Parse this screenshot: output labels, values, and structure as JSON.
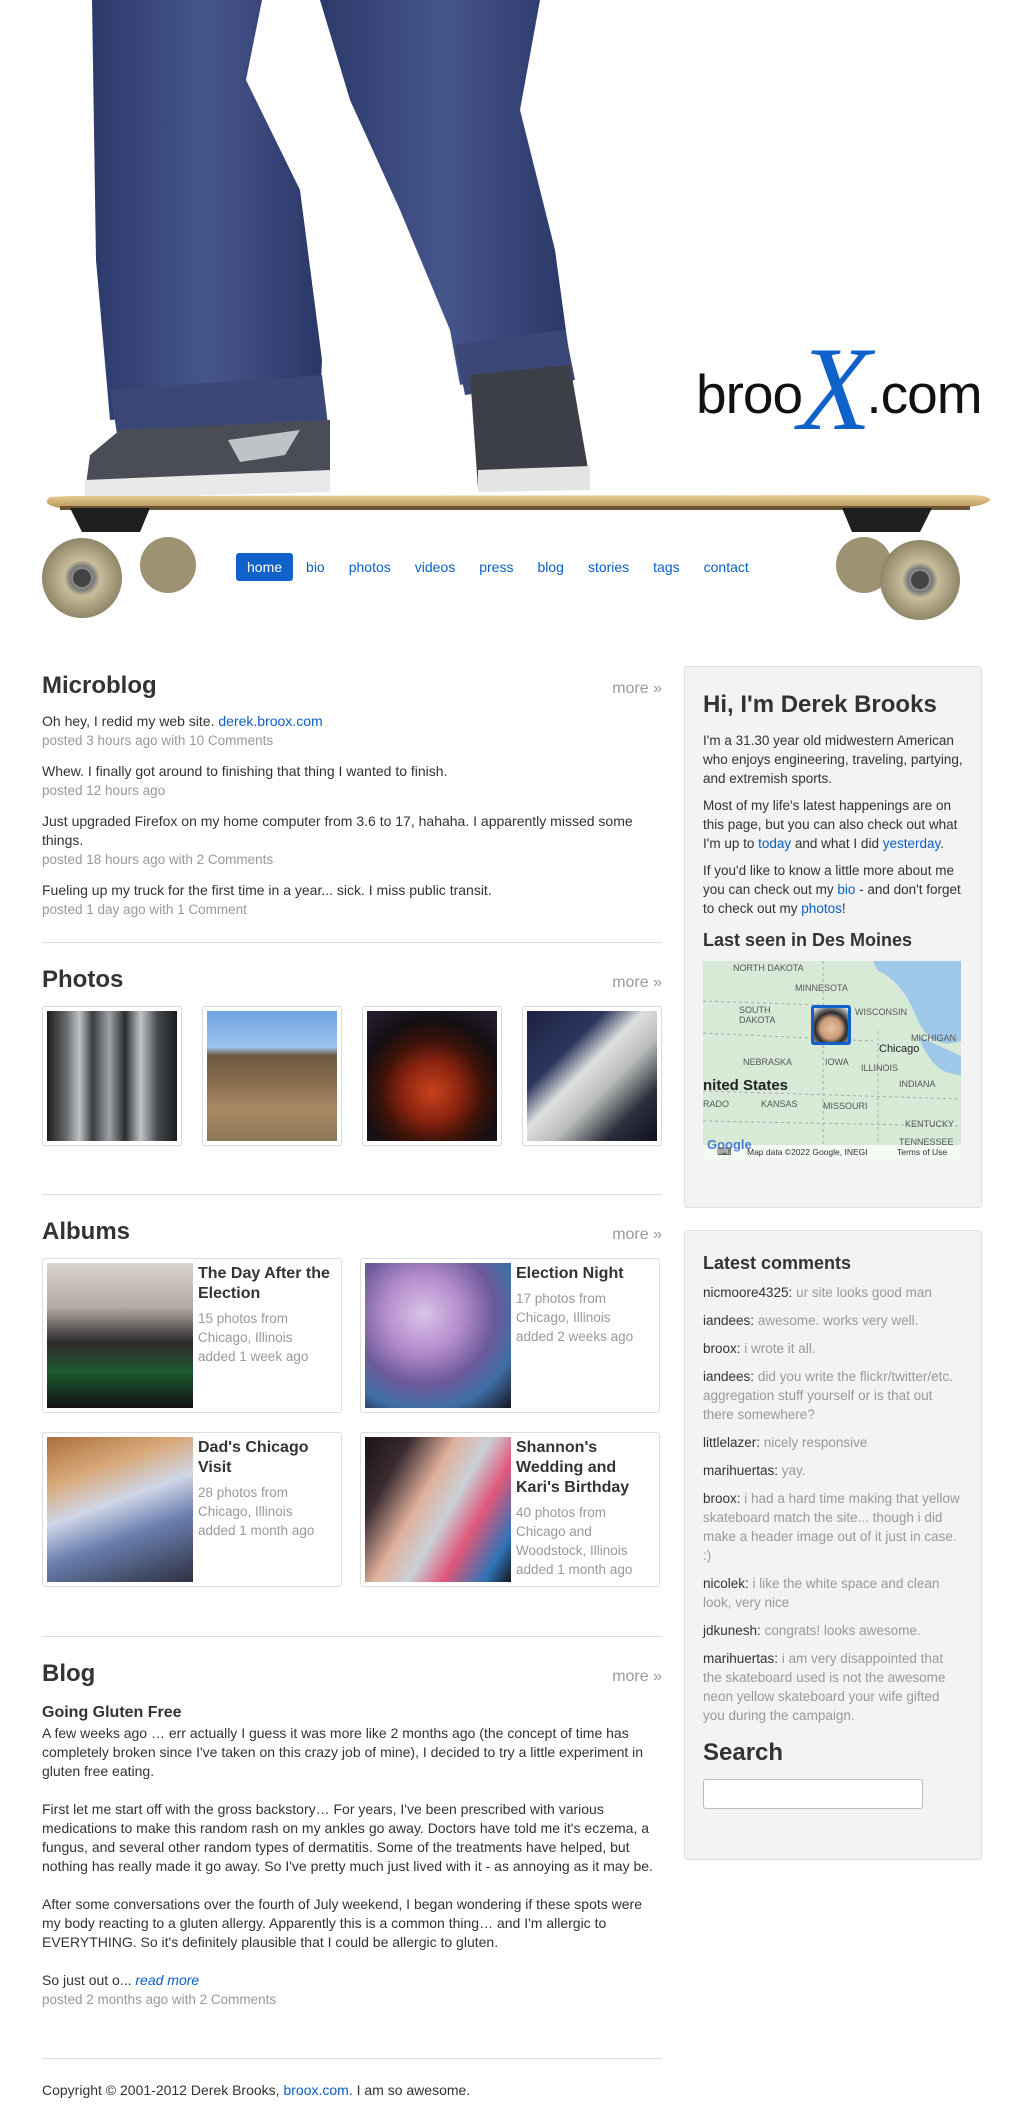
{
  "logo": {
    "prefix": "broo",
    "x": "X",
    "suffix": ".com"
  },
  "nav": [
    "home",
    "bio",
    "photos",
    "videos",
    "press",
    "blog",
    "stories",
    "tags",
    "contact"
  ],
  "microblog": {
    "title": "Microblog",
    "more": "more »",
    "items": [
      {
        "text": "Oh hey, I redid my web site. ",
        "link": "derek.broox.com",
        "meta": "posted 3 hours ago with 10 Comments"
      },
      {
        "text": "Whew. I finally got around to finishing that thing I wanted to finish.",
        "link": "",
        "meta": "posted 12 hours ago"
      },
      {
        "text": "Just upgraded Firefox on my home computer from 3.6 to 17, hahaha. I apparently missed some things.",
        "link": "",
        "meta": "posted 18 hours ago with 2 Comments"
      },
      {
        "text": "Fueling up my truck for the first time in a year... sick. I miss public transit.",
        "link": "",
        "meta": "posted 1 day ago with 1 Comment"
      }
    ]
  },
  "photos": {
    "title": "Photos",
    "more": "more »"
  },
  "albums": {
    "title": "Albums",
    "more": "more »",
    "items": [
      {
        "title": "The Day After the Election",
        "count": "15 photos from",
        "place": "Chicago, Illinois",
        "added": "added 1 week ago"
      },
      {
        "title": "Election Night",
        "count": "17 photos from",
        "place": "Chicago, Illinois",
        "added": "added 2 weeks ago"
      },
      {
        "title": "Dad's Chicago Visit",
        "count": "28 photos from",
        "place": "Chicago, Illinois",
        "added": "added 1 month ago"
      },
      {
        "title": "Shannon's Wedding and Kari's Birthday",
        "count": "40 photos from",
        "place": "Chicago and Woodstock, Illinois",
        "added": "added 1 month ago"
      }
    ]
  },
  "blog": {
    "title": "Blog",
    "more": "more »",
    "post_title": "Going Gluten Free",
    "p1": "A few weeks ago … err actually I guess it was more like 2 months ago (the concept of time has completely broken since I've taken on this crazy job of mine), I decided to try a little experiment in gluten free eating.",
    "p2": "First let me start off with the gross backstory… For years, I've been prescribed with various medications to make this random rash on my ankles go away. Doctors have told me it's eczema, a fungus, and several other random types of dermatitis. Some of the treatments have helped, but nothing has really made it go away. So I've pretty much just lived with it - as annoying as it may be.",
    "p3": "After some conversations over the fourth of July weekend, I began wondering if these spots were my body reacting to a gluten allergy. Apparently this is a common thing… and I'm allergic to EVERYTHING. So it's definitely plausible that I could be allergic to gluten.",
    "p4": "So just out o... ",
    "read_more": "read more",
    "meta": "posted 2 months ago with 2 Comments"
  },
  "about": {
    "title": "Hi, I'm Derek Brooks",
    "p1": "I'm a 31.30 year old midwestern American who enjoys engineering, traveling, partying, and extremish sports.",
    "p2a": "Most of my life's latest happenings are on this page, but you can also check out what I'm up to ",
    "today": "today",
    "p2b": " and what I did ",
    "yesterday": "yesterday",
    "p2c": ".",
    "p3a": "If you'd like to know a little more about me you can check out my ",
    "bio": "bio",
    "p3b": " - and don't forget to check out my ",
    "photos": "photos",
    "p3c": "!",
    "last_seen": "Last seen in Des Moines",
    "map": {
      "labels": [
        "NORTH DAKOTA",
        "MINNESOTA",
        "SOUTH DAKOTA",
        "WISCONSIN",
        "MICHIGAN",
        "NEBRASKA",
        "IOWA",
        "Chicago",
        "ILLINOIS",
        "INDIANA",
        "nited States",
        "KANSAS",
        "MISSOURI",
        "KENTUCKY",
        "RADO",
        "TENNESSEE"
      ],
      "attribution": "Map data ©2022 Google, INEGI",
      "terms": "Terms of Use",
      "google": "Google"
    }
  },
  "comments": {
    "title": "Latest comments",
    "items": [
      {
        "user": "nicmoore4325:",
        "text": "ur site looks good man"
      },
      {
        "user": "iandees:",
        "text": "awesome. works very well."
      },
      {
        "user": "broox:",
        "text": "i wrote it all."
      },
      {
        "user": "iandees:",
        "text": "did you write the flickr/twitter/etc. aggregation stuff yourself or is that out there somewhere?"
      },
      {
        "user": "littlelazer:",
        "text": "nicely responsive"
      },
      {
        "user": "marihuertas:",
        "text": "yay."
      },
      {
        "user": "broox:",
        "text": "i had a hard time making that yellow skateboard match the site... though i did make a header image out of it just in case. :)"
      },
      {
        "user": "nicolek:",
        "text": "i like the white space and clean look, very nice"
      },
      {
        "user": "jdkunesh:",
        "text": "congrats! looks awesome."
      },
      {
        "user": "marihuertas:",
        "text": "i am very disappointed that the skateboard used is not the awesome neon yellow skateboard your wife gifted you during the campaign."
      }
    ]
  },
  "search": {
    "title": "Search",
    "placeholder": ""
  },
  "footer": {
    "text": "Copyright © 2001-2012 Derek Brooks, ",
    "link": "broox.com",
    "suffix": ". I am so awesome."
  },
  "colors": {
    "accent": "#1061c9",
    "muted": "#999999",
    "sidebar_bg": "#f3f3f3"
  }
}
